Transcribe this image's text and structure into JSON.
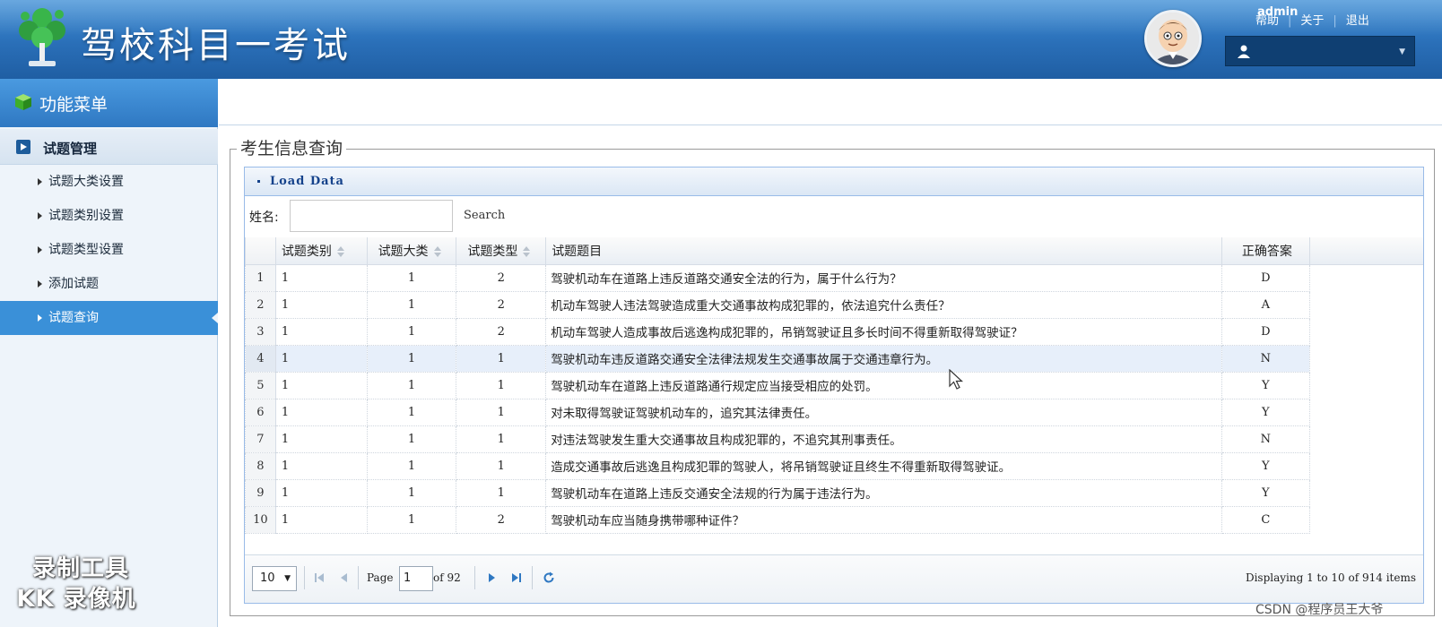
{
  "header": {
    "title": "驾校科目一考试",
    "username": "admin",
    "links": [
      "帮助",
      "关于",
      "退出"
    ],
    "icons": {
      "logo": "tree-logo-icon",
      "avatar": "cartoon-avatar",
      "user": "user-icon"
    }
  },
  "sidebar": {
    "menu_title": "功能菜单",
    "group": "试题管理",
    "items": [
      {
        "label": "试题大类设置",
        "active": false
      },
      {
        "label": "试题类别设置",
        "active": false
      },
      {
        "label": "试题类型设置",
        "active": false
      },
      {
        "label": "添加试题",
        "active": false
      },
      {
        "label": "试题查询",
        "active": true
      }
    ]
  },
  "main": {
    "legend": "考生信息查询",
    "panel_title": "Load Data",
    "search": {
      "label": "姓名:",
      "value": "",
      "button": "Search"
    },
    "columns": [
      "试题类别",
      "试题大类",
      "试题类型",
      "试题题目",
      "正确答案"
    ],
    "rows": [
      {
        "n": "1",
        "c1": "1",
        "c2": "1",
        "c3": "2",
        "q": "驾驶机动车在道路上违反道路交通安全法的行为，属于什么行为？",
        "a": "D"
      },
      {
        "n": "2",
        "c1": "1",
        "c2": "1",
        "c3": "2",
        "q": "机动车驾驶人违法驾驶造成重大交通事故构成犯罪的，依法追究什么责任？",
        "a": "A"
      },
      {
        "n": "3",
        "c1": "1",
        "c2": "1",
        "c3": "2",
        "q": "机动车驾驶人造成事故后逃逸构成犯罪的，吊销驾驶证且多长时间不得重新取得驾驶证？",
        "a": "D"
      },
      {
        "n": "4",
        "c1": "1",
        "c2": "1",
        "c3": "1",
        "q": "驾驶机动车违反道路交通安全法律法规发生交通事故属于交通违章行为。",
        "a": "N"
      },
      {
        "n": "5",
        "c1": "1",
        "c2": "1",
        "c3": "1",
        "q": "驾驶机动车在道路上违反道路通行规定应当接受相应的处罚。",
        "a": "Y"
      },
      {
        "n": "6",
        "c1": "1",
        "c2": "1",
        "c3": "1",
        "q": "对未取得驾驶证驾驶机动车的，追究其法律责任。",
        "a": "Y"
      },
      {
        "n": "7",
        "c1": "1",
        "c2": "1",
        "c3": "1",
        "q": "对违法驾驶发生重大交通事故且构成犯罪的，不追究其刑事责任。",
        "a": "N"
      },
      {
        "n": "8",
        "c1": "1",
        "c2": "1",
        "c3": "1",
        "q": "造成交通事故后逃逸且构成犯罪的驾驶人，将吊销驾驶证且终生不得重新取得驾驶证。",
        "a": "Y"
      },
      {
        "n": "9",
        "c1": "1",
        "c2": "1",
        "c3": "1",
        "q": "驾驶机动车在道路上违反交通安全法规的行为属于违法行为。",
        "a": "Y"
      },
      {
        "n": "10",
        "c1": "1",
        "c2": "1",
        "c3": "2",
        "q": "驾驶机动车应当随身携带哪种证件？",
        "a": "C"
      }
    ],
    "highlighted_row": 4,
    "pager": {
      "page_size": "10",
      "page_label": "Page",
      "page": "1",
      "of_label": "of 92",
      "display": "Displaying 1 to 10 of 914 items"
    }
  },
  "overlay": {
    "watermark_line1": "录制工具",
    "watermark_line2": "KK 录像机",
    "credit": "CSDN @程序员王大爷"
  },
  "colors": {
    "header": "#2a6fb8",
    "accent": "#3a90d8",
    "panel_border": "#99bbe8"
  }
}
